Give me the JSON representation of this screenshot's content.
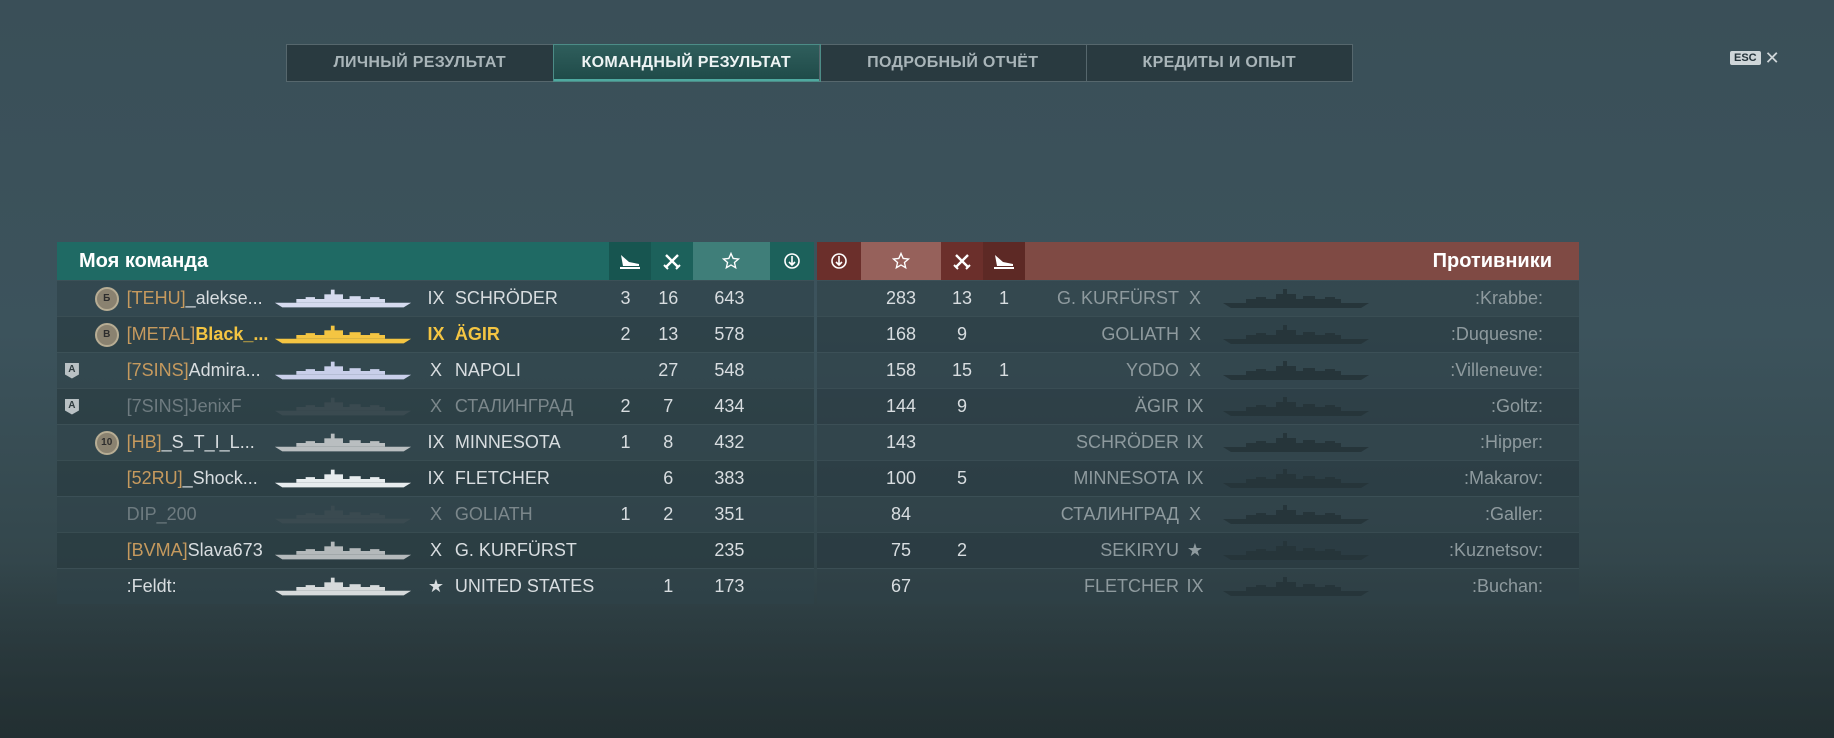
{
  "tabs": [
    {
      "label": "ЛИЧНЫЙ РЕЗУЛЬТАТ",
      "active": false
    },
    {
      "label": "КОМАНДНЫЙ РЕЗУЛЬТАТ",
      "active": true
    },
    {
      "label": "ПОДРОБНЫЙ ОТЧЁТ",
      "active": false
    },
    {
      "label": "КРЕДИТЫ И ОПЫТ",
      "active": false
    }
  ],
  "esc": {
    "key": "ESC",
    "close": "✕"
  },
  "my_team": {
    "title": "Моя команда",
    "color": "#1f6a64",
    "columns": [
      "plane-icon",
      "sword-icon",
      "star-icon",
      "wreath-icon"
    ],
    "players": [
      {
        "rank": "Б",
        "div": "",
        "clan": "[TEHU]",
        "name": "_alekse...",
        "tier": "IX",
        "ship": "SCHRÖDER",
        "planes": "3",
        "frags": "16",
        "score": "643",
        "ship_color": "#d5dbef",
        "style": "normal"
      },
      {
        "rank": "В",
        "div": "",
        "clan": "[METAL]",
        "name": "Black_...",
        "tier": "IX",
        "ship": "ÄGIR",
        "planes": "2",
        "frags": "13",
        "score": "578",
        "ship_color": "#f4c542",
        "style": "self"
      },
      {
        "rank": "",
        "div": "A",
        "clan": "[7SINS]",
        "name": "Admira...",
        "tier": "X",
        "ship": "NAPOLI",
        "planes": "",
        "frags": "27",
        "score": "548",
        "ship_color": "#c9cfea",
        "style": "normal"
      },
      {
        "rank": "",
        "div": "A",
        "clan": "[7SINS]",
        "name": "JenixF",
        "tier": "X",
        "ship": "СТАЛИНГРАД",
        "planes": "2",
        "frags": "7",
        "score": "434",
        "ship_color": "#3a4a50",
        "style": "dead"
      },
      {
        "rank": "10",
        "div": "",
        "clan": "[HB]",
        "name": "_S_T_I_L...",
        "tier": "IX",
        "ship": "MINNESOTA",
        "planes": "1",
        "frags": "8",
        "score": "432",
        "ship_color": "#b9bec0",
        "style": "normal"
      },
      {
        "rank": "",
        "div": "",
        "clan": "[52RU]",
        "name": "_Shock...",
        "tier": "IX",
        "ship": "FLETCHER",
        "planes": "",
        "frags": "6",
        "score": "383",
        "ship_color": "#e7ecee",
        "style": "normal"
      },
      {
        "rank": "",
        "div": "",
        "clan": "",
        "name": "DIP_200",
        "tier": "X",
        "ship": "GOLIATH",
        "planes": "1",
        "frags": "2",
        "score": "351",
        "ship_color": "#3a4a50",
        "style": "dead"
      },
      {
        "rank": "",
        "div": "",
        "clan": "[BVMA]",
        "name": "Slava673",
        "tier": "X",
        "ship": "G. KURFÜRST",
        "planes": "",
        "frags": "",
        "score": "235",
        "ship_color": "#b4b9bb",
        "style": "normal"
      },
      {
        "rank": "",
        "div": "",
        "clan": "",
        "name": ":Feldt:",
        "tier": "★",
        "ship": "UNITED STATES",
        "planes": "",
        "frags": "1",
        "score": "173",
        "ship_color": "#d6dadb",
        "style": "normal"
      }
    ]
  },
  "enemies": {
    "title": "Противники",
    "color": "#7a3d38",
    "players": [
      {
        "score": "283",
        "frags": "13",
        "planes": "1",
        "ship": "G. KURFÜRST",
        "tier": "X",
        "name": ":Krabbe:"
      },
      {
        "score": "168",
        "frags": "9",
        "planes": "",
        "ship": "GOLIATH",
        "tier": "X",
        "name": ":Duquesne:"
      },
      {
        "score": "158",
        "frags": "15",
        "planes": "1",
        "ship": "YODO",
        "tier": "X",
        "name": ":Villeneuve:"
      },
      {
        "score": "144",
        "frags": "9",
        "planes": "",
        "ship": "ÄGIR",
        "tier": "IX",
        "name": ":Goltz:"
      },
      {
        "score": "143",
        "frags": "",
        "planes": "",
        "ship": "SCHRÖDER",
        "tier": "IX",
        "name": ":Hipper:"
      },
      {
        "score": "100",
        "frags": "5",
        "planes": "",
        "ship": "MINNESOTA",
        "tier": "IX",
        "name": ":Makarov:"
      },
      {
        "score": "84",
        "frags": "",
        "planes": "",
        "ship": "СТАЛИНГРАД",
        "tier": "X",
        "name": ":Galler:"
      },
      {
        "score": "75",
        "frags": "2",
        "planes": "",
        "ship": "SEKIRYU",
        "tier": "★",
        "name": ":Kuznetsov:"
      },
      {
        "score": "67",
        "frags": "",
        "planes": "",
        "ship": "FLETCHER",
        "tier": "IX",
        "name": ":Buchan:"
      }
    ]
  }
}
